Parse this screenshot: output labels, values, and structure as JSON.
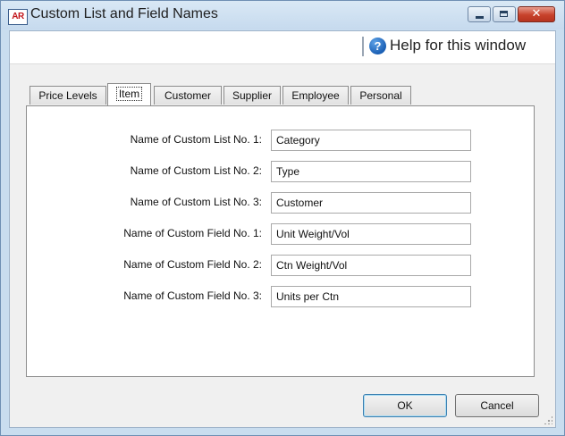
{
  "window": {
    "title": "Custom List and Field Names",
    "app_icon_text": "AR",
    "controls": {
      "minimize": "–",
      "maximize": "□",
      "close": "✕"
    }
  },
  "help": {
    "icon_text": "?",
    "label": "Help for this window"
  },
  "tabs": [
    {
      "label": "Price Levels",
      "active": false
    },
    {
      "label": "Item",
      "active": true
    },
    {
      "label": "Customer",
      "active": false
    },
    {
      "label": "Supplier",
      "active": false
    },
    {
      "label": "Employee",
      "active": false
    },
    {
      "label": "Personal",
      "active": false
    }
  ],
  "fields": [
    {
      "label": "Name of Custom List No. 1:",
      "value": "Category"
    },
    {
      "label": "Name of Custom List No. 2:",
      "value": "Type"
    },
    {
      "label": "Name of Custom List No. 3:",
      "value": "Customer"
    },
    {
      "label": "Name of Custom Field No. 1:",
      "value": "Unit Weight/Vol"
    },
    {
      "label": "Name of Custom Field No. 2:",
      "value": "Ctn Weight/Vol"
    },
    {
      "label": "Name of Custom Field No. 3:",
      "value": "Units per Ctn"
    }
  ],
  "buttons": {
    "ok": "OK",
    "cancel": "Cancel"
  }
}
